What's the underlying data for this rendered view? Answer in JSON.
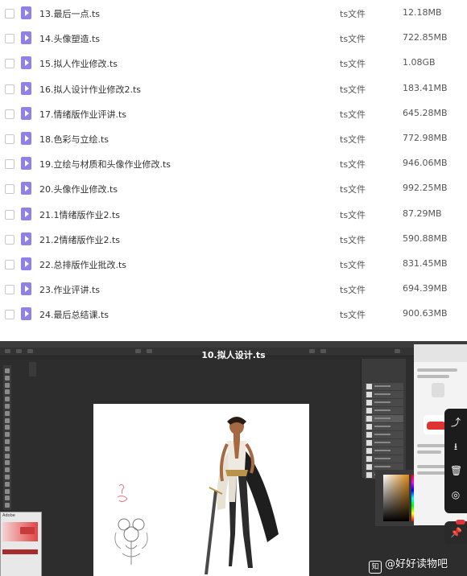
{
  "file_list": {
    "rows": [
      {
        "name": "13.最后一点.ts",
        "type": "ts文件",
        "size": "12.18MB"
      },
      {
        "name": "14.头像塑造.ts",
        "type": "ts文件",
        "size": "722.85MB"
      },
      {
        "name": "15.拟人作业修改.ts",
        "type": "ts文件",
        "size": "1.08GB"
      },
      {
        "name": "16.拟人设计作业修改2.ts",
        "type": "ts文件",
        "size": "183.41MB"
      },
      {
        "name": "17.情绪版作业评讲.ts",
        "type": "ts文件",
        "size": "645.28MB"
      },
      {
        "name": "18.色彩与立绘.ts",
        "type": "ts文件",
        "size": "772.98MB"
      },
      {
        "name": "19.立绘与材质和头像作业修改.ts",
        "type": "ts文件",
        "size": "946.06MB"
      },
      {
        "name": "20.头像作业修改.ts",
        "type": "ts文件",
        "size": "992.25MB"
      },
      {
        "name": "21.1情绪版作业2.ts",
        "type": "ts文件",
        "size": "87.29MB"
      },
      {
        "name": "21.2情绪版作业2.ts",
        "type": "ts文件",
        "size": "590.88MB"
      },
      {
        "name": "22.总排版作业批改.ts",
        "type": "ts文件",
        "size": "831.45MB"
      },
      {
        "name": "23.作业评讲.ts",
        "type": "ts文件",
        "size": "694.39MB"
      },
      {
        "name": "24.最后总结课.ts",
        "type": "ts文件",
        "size": "900.63MB"
      }
    ]
  },
  "player": {
    "title": "10.拟人设计.ts",
    "popup_title": "Adobe"
  },
  "watermark": {
    "logo": "知",
    "text": "@好好读物吧"
  },
  "colors": {
    "file_icon": "#8e82e8",
    "accent_red": "#e0353b",
    "player_bg": "#2d2d2d"
  },
  "icons": [
    "checkbox",
    "video-file-icon",
    "share-icon",
    "download-icon",
    "trash-icon",
    "target-icon",
    "pin-icon"
  ]
}
